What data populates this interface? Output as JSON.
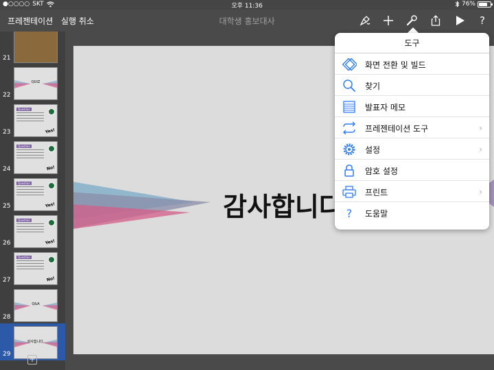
{
  "status": {
    "signal": "●○○○○",
    "carrier": "SKT",
    "time": "오후 11:36",
    "battery": "76%",
    "battery_level": 0.76
  },
  "toolbar": {
    "presentations_label": "프레젠테이션",
    "undo_label": "실행 취소",
    "document_title": "대학생 홍보대사",
    "help_label": "?"
  },
  "navigator": {
    "slides": [
      {
        "number": "21",
        "kind": "image"
      },
      {
        "number": "22",
        "kind": "title",
        "title": "QUIZ"
      },
      {
        "number": "23",
        "kind": "question",
        "tag": "Question",
        "answer": "Yes!"
      },
      {
        "number": "24",
        "kind": "question",
        "tag": "Question",
        "answer": "No!"
      },
      {
        "number": "25",
        "kind": "question",
        "tag": "Question",
        "answer": "Yes!"
      },
      {
        "number": "26",
        "kind": "question",
        "tag": "Question",
        "answer": "Yes!"
      },
      {
        "number": "27",
        "kind": "question",
        "tag": "Question",
        "answer": "No!"
      },
      {
        "number": "28",
        "kind": "title",
        "title": "Q&A"
      },
      {
        "number": "29",
        "kind": "title",
        "title": "감사합니다.",
        "selected": true
      }
    ],
    "add_label": "+"
  },
  "slide": {
    "title": "감사합니다"
  },
  "tools_menu": {
    "title": "도구",
    "items": [
      {
        "label": "화면 전환 및 빌드",
        "icon": "transition-icon",
        "chevron": false
      },
      {
        "label": "찾기",
        "icon": "search-icon",
        "chevron": false
      },
      {
        "label": "발표자 메모",
        "icon": "presenter-notes-icon",
        "chevron": false
      },
      {
        "label": "프레젠테이션 도구",
        "icon": "presentation-tools-icon",
        "chevron": true
      },
      {
        "label": "설정",
        "icon": "gear-icon",
        "chevron": true
      },
      {
        "label": "암호 설정",
        "icon": "lock-icon",
        "chevron": false
      },
      {
        "label": "프린트",
        "icon": "print-icon",
        "chevron": true
      },
      {
        "label": "도움말",
        "icon": "help-icon",
        "chevron": false
      }
    ]
  },
  "colors": {
    "accent": "#2f7cf6",
    "selected_slide": "#2d5aa8",
    "toolbar_bg": "#4a4a4a"
  }
}
